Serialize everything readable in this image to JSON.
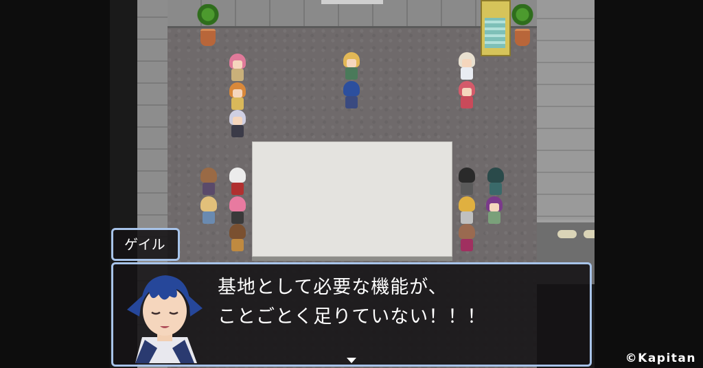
{
  "dialog": {
    "speaker": "ゲイル",
    "line1": "基地として必要な機能が、",
    "line2": "ことごとく足りていない！！！"
  },
  "copyright": "©Kapitan",
  "colors": {
    "window_border": "#a8c4ea",
    "window_bg": "#141214",
    "floor": "#6f6a6b",
    "table": "#e4e3df"
  },
  "scene": {
    "characters": [
      {
        "name": "pink-haired-girl",
        "hair": "#e07a9a",
        "body": "#c9b07a",
        "facing": "front"
      },
      {
        "name": "orange-haired-girl",
        "hair": "#d9883a",
        "body": "#d9b85a",
        "facing": "front"
      },
      {
        "name": "silver-haired-boy",
        "hair": "#cfcfe2",
        "body": "#3b3b48",
        "facing": "front"
      },
      {
        "name": "blonde-spiky-boy",
        "hair": "#e2b856",
        "body": "#4a7a5a",
        "facing": "front"
      },
      {
        "name": "blue-haired-hero",
        "hair": "#2c4f9e",
        "body": "#3a4a80",
        "facing": "back"
      },
      {
        "name": "nurse-cap-girl",
        "hair": "#e8e0d0",
        "body": "#e9ecf2",
        "facing": "front"
      },
      {
        "name": "red-haired-girl",
        "hair": "#d45a6a",
        "body": "#c94a5a",
        "facing": "front"
      },
      {
        "name": "brown-haired-back",
        "hair": "#9a6a45",
        "body": "#5a4a6a",
        "facing": "back"
      },
      {
        "name": "white-haired-back",
        "hair": "#ececec",
        "body": "#b03030",
        "facing": "back"
      },
      {
        "name": "blonde-back",
        "hair": "#e2c07a",
        "body": "#6a8ab0",
        "facing": "back"
      },
      {
        "name": "pink-back",
        "hair": "#e87aa0",
        "body": "#3a3a3a",
        "facing": "back"
      },
      {
        "name": "brown-short-back",
        "hair": "#7a5030",
        "body": "#c08a40",
        "facing": "back"
      },
      {
        "name": "black-haired-back",
        "hair": "#2a2a2a",
        "body": "#5a5a5a",
        "facing": "back"
      },
      {
        "name": "teal-haired-back",
        "hair": "#2a4a4a",
        "body": "#3a6a6a",
        "facing": "back"
      },
      {
        "name": "blonde-curly-back",
        "hair": "#e0b040",
        "body": "#c0c0c0",
        "facing": "back"
      },
      {
        "name": "witch-hat-girl",
        "hair": "#7a3a8a",
        "body": "#7aa07a",
        "facing": "front"
      },
      {
        "name": "brown-long-back",
        "hair": "#9a6a50",
        "body": "#a03060",
        "facing": "back"
      }
    ]
  }
}
